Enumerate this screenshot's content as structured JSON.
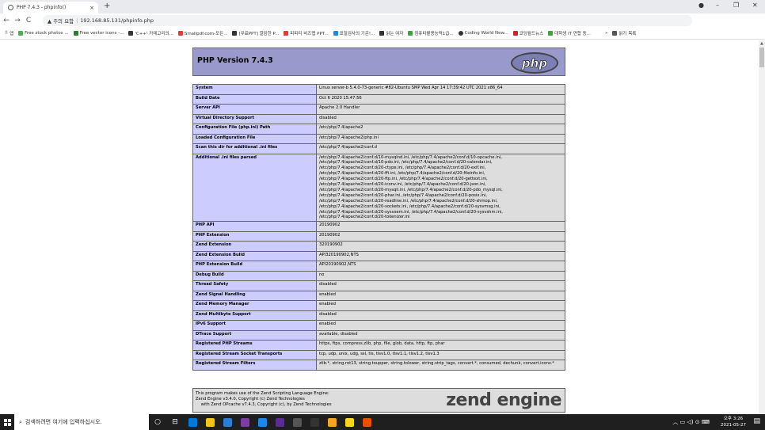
{
  "browser": {
    "tab_title": "PHP 7.4.3 - phpinfo()",
    "tab_close": "×",
    "new_tab": "+",
    "url_warning": "▲ 주의 요함",
    "url_separator": "|",
    "url": "192.168.85.131/phpinfo.php",
    "window_controls": [
      "–",
      "❐",
      "✕"
    ],
    "bookmarks": [
      {
        "label": "앱",
        "color": "#5f6368"
      },
      {
        "label": "Free stock photos ...",
        "color": "#4caf50"
      },
      {
        "label": "Free vector icons -...",
        "color": "#2e7d32"
      },
      {
        "label": "'C++' 카테고리의...",
        "color": "#333333"
      },
      {
        "label": "Smallpdf.com-모든...",
        "color": "#e53935"
      },
      {
        "label": "[무료PPT] 깔끔한 P...",
        "color": "#333333"
      },
      {
        "label": "피피티 비즈맵 PPT...",
        "color": "#e53935"
      },
      {
        "label": "표절검사의 기준!...",
        "color": "#1e88e5"
      },
      {
        "label": "읽는 여자",
        "color": "#333333"
      },
      {
        "label": "컴퓨터활용능력1급...",
        "color": "#43a047"
      },
      {
        "label": "Coding World New...",
        "color": "#333333"
      },
      {
        "label": "코딩월드뉴스",
        "color": "#c62828"
      },
      {
        "label": "대학생 IT 연합 동...",
        "color": "#43a047"
      }
    ],
    "bookmarks_more": "»",
    "reading_list": "읽기 목록"
  },
  "php": {
    "version_title": "PHP Version 7.4.3",
    "logo_text": "php",
    "rows": [
      {
        "k": "System",
        "v": "Linux server-b 5.4.0-73-generic #82-Ubuntu SMP Wed Apr 14 17:39:42 UTC 2021 x86_64"
      },
      {
        "k": "Build Date",
        "v": "Oct 6 2020 15:47:56"
      },
      {
        "k": "Server API",
        "v": "Apache 2.0 Handler"
      },
      {
        "k": "Virtual Directory Support",
        "v": "disabled"
      },
      {
        "k": "Configuration File (php.ini) Path",
        "v": "/etc/php/7.4/apache2"
      },
      {
        "k": "Loaded Configuration File",
        "v": "/etc/php/7.4/apache2/php.ini"
      },
      {
        "k": "Scan this dir for additional .ini files",
        "v": "/etc/php/7.4/apache2/conf.d"
      },
      {
        "k": "Additional .ini files parsed",
        "v": "/etc/php/7.4/apache2/conf.d/10-mysqlnd.ini, /etc/php/7.4/apache2/conf.d/10-opcache.ini,\n/etc/php/7.4/apache2/conf.d/10-pdo.ini, /etc/php/7.4/apache2/conf.d/20-calendar.ini,\n/etc/php/7.4/apache2/conf.d/20-ctype.ini, /etc/php/7.4/apache2/conf.d/20-exif.ini,\n/etc/php/7.4/apache2/conf.d/20-ffi.ini, /etc/php/7.4/apache2/conf.d/20-fileinfo.ini,\n/etc/php/7.4/apache2/conf.d/20-ftp.ini, /etc/php/7.4/apache2/conf.d/20-gettext.ini,\n/etc/php/7.4/apache2/conf.d/20-iconv.ini, /etc/php/7.4/apache2/conf.d/20-json.ini,\n/etc/php/7.4/apache2/conf.d/20-mysqli.ini, /etc/php/7.4/apache2/conf.d/20-pdo_mysql.ini,\n/etc/php/7.4/apache2/conf.d/20-phar.ini, /etc/php/7.4/apache2/conf.d/20-posix.ini,\n/etc/php/7.4/apache2/conf.d/20-readline.ini, /etc/php/7.4/apache2/conf.d/20-shmop.ini,\n/etc/php/7.4/apache2/conf.d/20-sockets.ini, /etc/php/7.4/apache2/conf.d/20-sysvmsg.ini,\n/etc/php/7.4/apache2/conf.d/20-sysvsem.ini, /etc/php/7.4/apache2/conf.d/20-sysvshm.ini,\n/etc/php/7.4/apache2/conf.d/20-tokenizer.ini",
        "multi": true
      },
      {
        "k": "PHP API",
        "v": "20190902"
      },
      {
        "k": "PHP Extension",
        "v": "20190902"
      },
      {
        "k": "Zend Extension",
        "v": "320190902"
      },
      {
        "k": "Zend Extension Build",
        "v": "API320190902,NTS"
      },
      {
        "k": "PHP Extension Build",
        "v": "API20190902,NTS"
      },
      {
        "k": "Debug Build",
        "v": "no"
      },
      {
        "k": "Thread Safety",
        "v": "disabled"
      },
      {
        "k": "Zend Signal Handling",
        "v": "enabled"
      },
      {
        "k": "Zend Memory Manager",
        "v": "enabled"
      },
      {
        "k": "Zend Multibyte Support",
        "v": "disabled"
      },
      {
        "k": "IPv6 Support",
        "v": "enabled"
      },
      {
        "k": "DTrace Support",
        "v": "available, disabled"
      },
      {
        "k": "Registered PHP Streams",
        "v": "https, ftps, compress.zlib, php, file, glob, data, http, ftp, phar"
      },
      {
        "k": "Registered Stream Socket Transports",
        "v": "tcp, udp, unix, udg, ssl, tls, tlsv1.0, tlsv1.1, tlsv1.2, tlsv1.3"
      },
      {
        "k": "Registered Stream Filters",
        "v": "zlib.*, string.rot13, string.toupper, string.tolower, string.strip_tags, convert.*, consumed, dechunk, convert.iconv.*"
      }
    ],
    "zend_text": "This program makes use of the Zend Scripting Language Engine:\nZend Engine v3.4.0, Copyright (c) Zend Technologies\n    with Zend OPcache v7.4.3, Copyright (c), by Zend Technologies",
    "zend_logo": "zend engine"
  },
  "taskbar": {
    "search_placeholder": "검색하려면 여기에 입력하십시오.",
    "time": "오후 3:26",
    "date": "2021-05-27",
    "apps": [
      "#0078d7",
      "#f0c419",
      "#2d7dd2",
      "#7b3fa0",
      "#1e88e5",
      "#5c2d91",
      "#555555",
      "#333333",
      "#f5a623",
      "#f9d71c",
      "#e65100"
    ]
  }
}
